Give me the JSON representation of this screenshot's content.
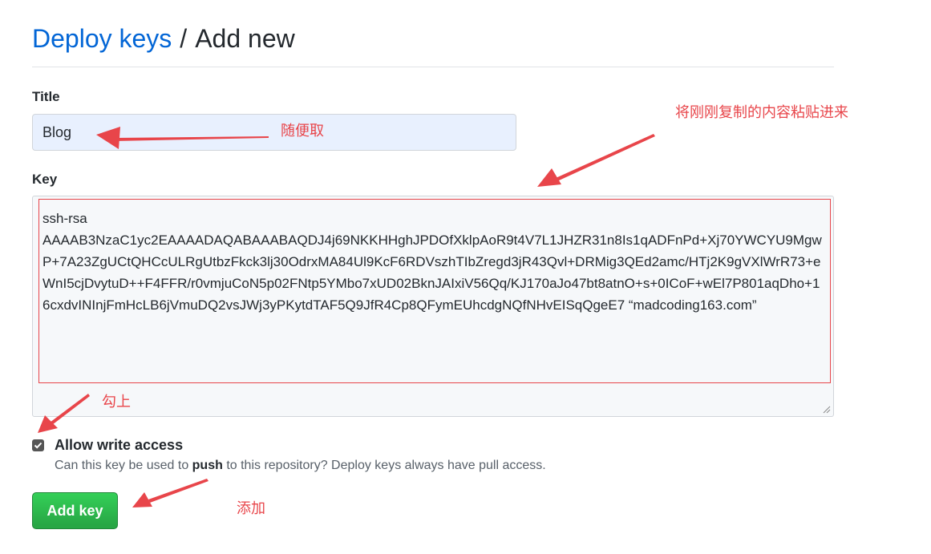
{
  "breadcrumb": {
    "link": "Deploy keys",
    "separator": "/",
    "current": "Add new"
  },
  "form": {
    "title_label": "Title",
    "title_value": "Blog",
    "key_label": "Key",
    "key_value": "ssh-rsa\nAAAAB3NzaC1yc2EAAAADAQABAAABAQDJ4j69NKKHHghJPDOfXklpAoR9t4V7L1JHZR31n8Is1qADFnPd+Xj70YWCYU9MgwP+7A23ZgUCtQHCcULRgUtbzFkck3lj30OdrxMA84Ul9KcF6RDVszhTIbZregd3jR43Qvl+DRMig3QEd2amc/HTj2K9gVXlWrR73+eWnI5cjDvytuD++F4FFR/r0vmjuCoN5p02FNtp5YMbo7xUD02BknJAIxiV56Qq/KJ170aJo47bt8atnO+s+0ICoF+wEl7P801aqDho+16cxdvINInjFmHcLB6jVmuDQ2vsJWj3yPKytdTAF5Q9JfR4Cp8QFymEUhcdgNQfNHvEISqQgeE7 “madcoding163.com”",
    "checkbox_label": "Allow write access",
    "checkbox_checked": true,
    "help_prefix": "Can this key be used to ",
    "help_bold": "push",
    "help_suffix": " to this repository? Deploy keys always have pull access.",
    "submit_label": "Add key"
  },
  "annotations": {
    "title_note": "随便取",
    "key_note": "将刚刚复制的内容粘贴进来",
    "checkbox_note": "勾上",
    "button_note": "添加"
  },
  "colors": {
    "link": "#0366d6",
    "annotation": "#e8454a",
    "button": "#28a745",
    "title_input_bg": "#e8f0fe"
  }
}
